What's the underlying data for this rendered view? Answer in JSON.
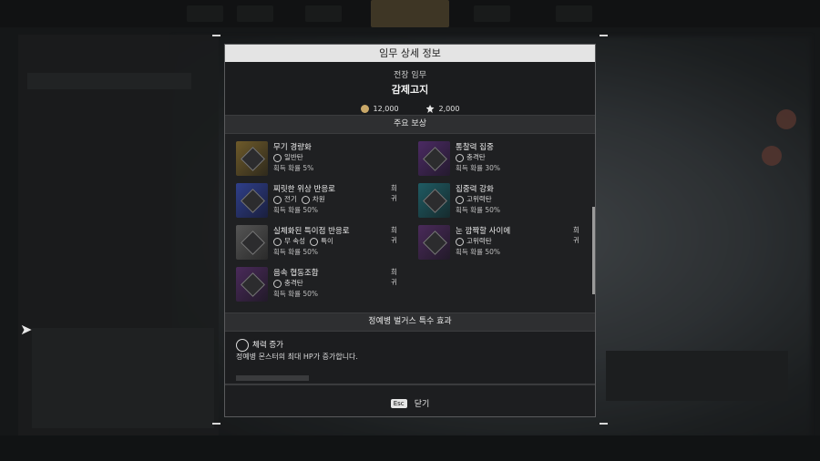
{
  "modal": {
    "title": "임무 상세 정보",
    "mission_type": "전장 임무",
    "mission_name": "감제고지",
    "gold": "12,000",
    "xp": "2,000",
    "rewards_header": "주요 보상",
    "rewards": [
      {
        "name": "무기 경량화",
        "tags": [
          "일반탄"
        ],
        "prob": "획득 확률 5%",
        "rare": "",
        "colors": [
          "#6e5a2a",
          "#2f2a1c"
        ]
      },
      {
        "name": "통찰력 집중",
        "tags": [
          "충격탄"
        ],
        "prob": "획득 확률 30%",
        "rare": "",
        "colors": [
          "#4b2a63",
          "#241a2e"
        ]
      },
      {
        "name": "찌릿한 위상 반응로",
        "tags": [
          "전기",
          "차원"
        ],
        "prob": "획득 확률 50%",
        "rare": "희귀",
        "colors": [
          "#2f3f8a",
          "#1a1f3e"
        ]
      },
      {
        "name": "집중력 강화",
        "tags": [
          "고위력탄"
        ],
        "prob": "획득 확률 50%",
        "rare": "",
        "colors": [
          "#1f5b63",
          "#162b2e"
        ]
      },
      {
        "name": "실체화된 특이점 반응로",
        "tags": [
          "무 속성",
          "특이"
        ],
        "prob": "획득 확률 50%",
        "rare": "희귀",
        "colors": [
          "#555",
          "#2a2a2a"
        ]
      },
      {
        "name": "눈 깜짝할 사이에",
        "tags": [
          "고위력탄"
        ],
        "prob": "획득 확률 50%",
        "rare": "희귀",
        "colors": [
          "#4a2a5a",
          "#221a29"
        ]
      },
      {
        "name": "음속 협동조합",
        "tags": [
          "충격탄"
        ],
        "prob": "획득 확률 50%",
        "rare": "희귀",
        "colors": [
          "#4a2a5a",
          "#221a29"
        ]
      }
    ],
    "effects_header": "정예병 벌거스 특수 효과",
    "effect_title": "체력 증가",
    "effect_desc": "정예병 몬스터의 최대 HP가 증가합니다.",
    "esc_key": "Esc",
    "close_label": "닫기"
  }
}
